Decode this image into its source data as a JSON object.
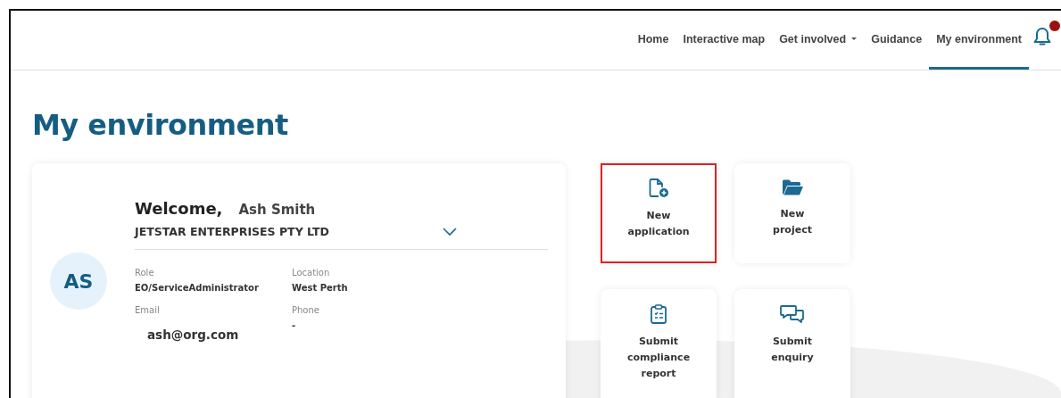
{
  "nav": {
    "items": [
      {
        "label": "Home",
        "selected": false,
        "kind": "link"
      },
      {
        "label": "Interactive map",
        "selected": false,
        "kind": "link"
      },
      {
        "label": "Get involved",
        "selected": false,
        "kind": "dropdown"
      },
      {
        "label": "Guidance",
        "selected": false,
        "kind": "link"
      },
      {
        "label": "My environment",
        "selected": true,
        "kind": "link"
      }
    ],
    "notifications": {
      "unread": true
    }
  },
  "page_title": "My environment",
  "profile": {
    "initials": "AS",
    "greeting": "Welcome,",
    "name": "Ash Smith",
    "organisation": "JETSTAR ENTERPRISES PTY LTD",
    "fields": [
      {
        "label": "Role",
        "value": "EO/ServiceAdministrator",
        "kind": "small"
      },
      {
        "label": "Location",
        "value": "West Perth",
        "kind": "small"
      },
      {
        "label": "Email",
        "value": "ash@org.com",
        "kind": "large"
      },
      {
        "label": "Phone",
        "value": "-",
        "kind": "small"
      }
    ]
  },
  "actions": [
    {
      "label": "New application",
      "kind": "file-plus",
      "highlighted": true
    },
    {
      "label": "New project",
      "kind": "folder",
      "highlighted": false
    },
    {
      "label": "Submit compliance report",
      "kind": "clipboard",
      "highlighted": false
    },
    {
      "label": "Submit enquiry",
      "kind": "chat",
      "highlighted": false
    }
  ]
}
